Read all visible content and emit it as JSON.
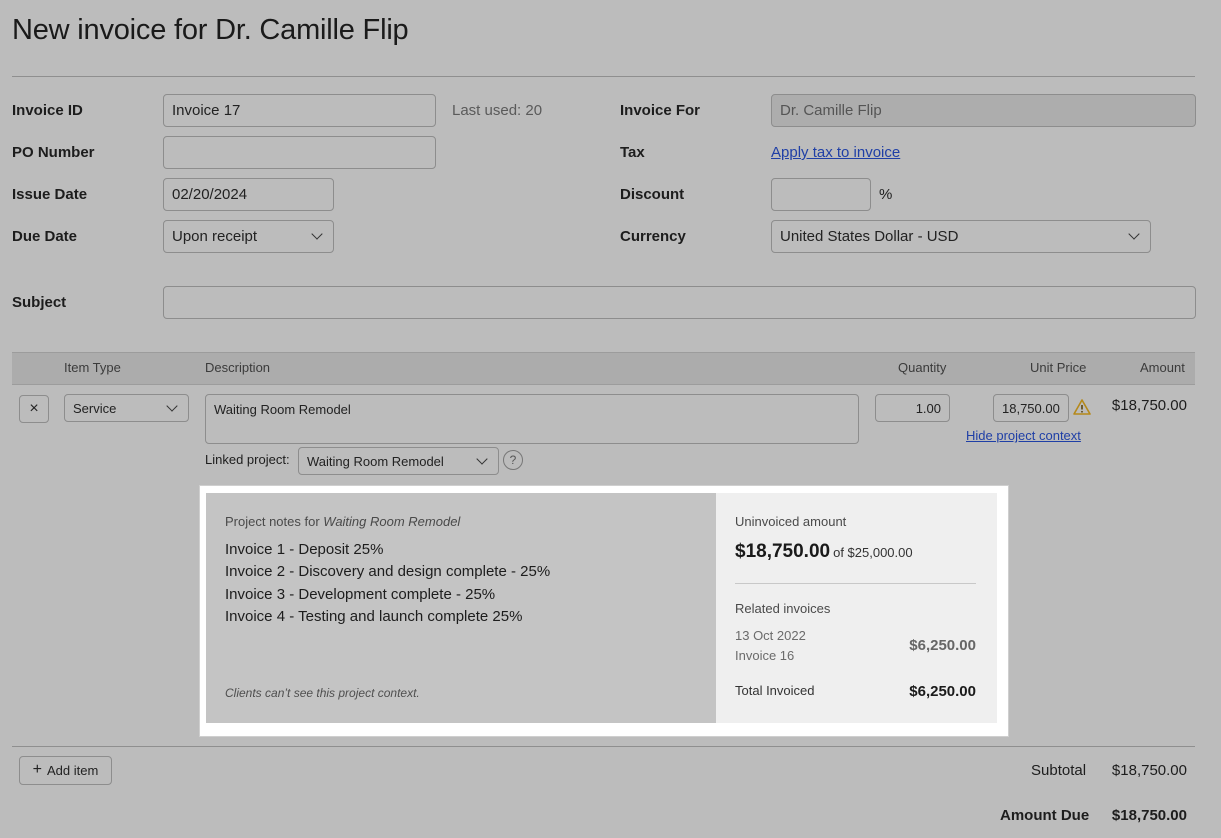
{
  "page": {
    "title": "New invoice for Dr. Camille Flip"
  },
  "form": {
    "invoice_id": {
      "label": "Invoice ID",
      "value": "Invoice 17",
      "last_used": "Last used: 20"
    },
    "po_number": {
      "label": "PO Number",
      "value": ""
    },
    "issue_date": {
      "label": "Issue Date",
      "value": "02/20/2024"
    },
    "due_date": {
      "label": "Due Date",
      "value": "Upon receipt"
    },
    "invoice_for": {
      "label": "Invoice For",
      "value": "Dr. Camille Flip"
    },
    "tax": {
      "label": "Tax",
      "link": "Apply tax to invoice"
    },
    "discount": {
      "label": "Discount",
      "value": "",
      "unit": "%"
    },
    "currency": {
      "label": "Currency",
      "value": "United States Dollar - USD"
    },
    "subject": {
      "label": "Subject",
      "value": ""
    }
  },
  "table": {
    "headers": {
      "item_type": "Item Type",
      "description": "Description",
      "quantity": "Quantity",
      "unit_price": "Unit Price",
      "amount": "Amount"
    },
    "rows": [
      {
        "remove": "×",
        "item_type": "Service",
        "description": "Waiting Room Remodel",
        "quantity": "1.00",
        "unit_price": "18,750.00",
        "amount": "$18,750.00",
        "hide_context_link": "Hide project context",
        "linked_project_label": "Linked project:",
        "linked_project": "Waiting Room Remodel",
        "help": "?"
      }
    ]
  },
  "context": {
    "heading_prefix": "Project notes for",
    "heading_project": "Waiting Room Remodel",
    "notes": [
      "Invoice 1 - Deposit 25%",
      "Invoice 2 - Discovery and design complete - 25%",
      "Invoice 3 - Development complete - 25%",
      "Invoice 4 - Testing and launch complete 25%"
    ],
    "footer": "Clients can’t see this project context.",
    "uninvoiced_label": "Uninvoiced amount",
    "uninvoiced_amount": "$18,750.00",
    "uninvoiced_of": "of $25,000.00",
    "related_label": "Related invoices",
    "related": [
      {
        "date": "13 Oct 2022",
        "name": "Invoice 16",
        "amount": "$6,250.00"
      }
    ],
    "total_label": "Total Invoiced",
    "total_value": "$6,250.00"
  },
  "footer": {
    "add_item": "Add item",
    "subtotal_label": "Subtotal",
    "subtotal_value": "$18,750.00",
    "amount_due_label": "Amount Due",
    "amount_due_value": "$18,750.00"
  },
  "colors": {
    "background": "#bcbcbc",
    "link": "#1f3fa6",
    "panel": "#ffffff",
    "warning": "#c79a1a"
  },
  "icons": [
    "close-icon",
    "chevron-down-icon",
    "warning-icon",
    "help-icon",
    "plus-icon"
  ]
}
